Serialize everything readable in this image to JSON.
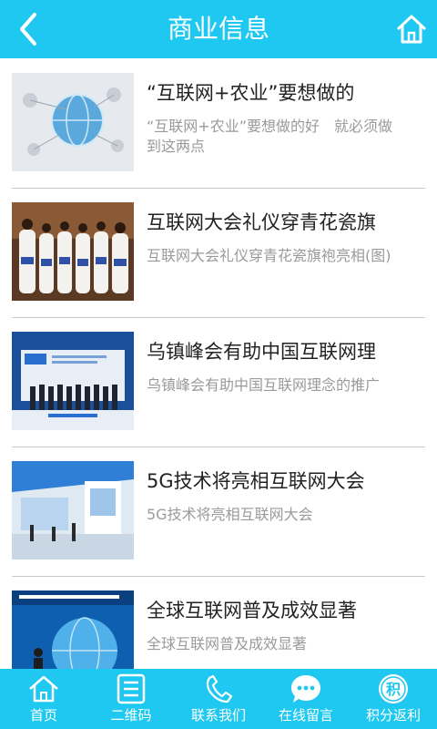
{
  "header": {
    "title": "商业信息"
  },
  "items": [
    {
      "title": "“互联网+农业”要想做的",
      "desc": "“互联网+农业”要想做的好　就必须做到这两点"
    },
    {
      "title": "互联网大会礼仪穿青花瓷旗",
      "desc": "互联网大会礼仪穿青花瓷旗袍亮相(图)"
    },
    {
      "title": "乌镇峰会有助中国互联网理",
      "desc": "乌镇峰会有助中国互联网理念的推广"
    },
    {
      "title": "5G技术将亮相互联网大会",
      "desc": "5G技术将亮相互联网大会"
    },
    {
      "title": "全球互联网普及成效显著",
      "desc": "全球互联网普及成效显著"
    }
  ],
  "tabbar": [
    {
      "label": "首页",
      "icon": "home-icon"
    },
    {
      "label": "二维码",
      "icon": "qrcode-icon"
    },
    {
      "label": "联系我们",
      "icon": "phone-icon"
    },
    {
      "label": "在线留言",
      "icon": "chat-icon"
    },
    {
      "label": "积分返利",
      "icon": "points-icon"
    }
  ],
  "colors": {
    "accent": "#1ec8f0",
    "title_text": "#222222",
    "desc_text": "#9a9a9a"
  }
}
